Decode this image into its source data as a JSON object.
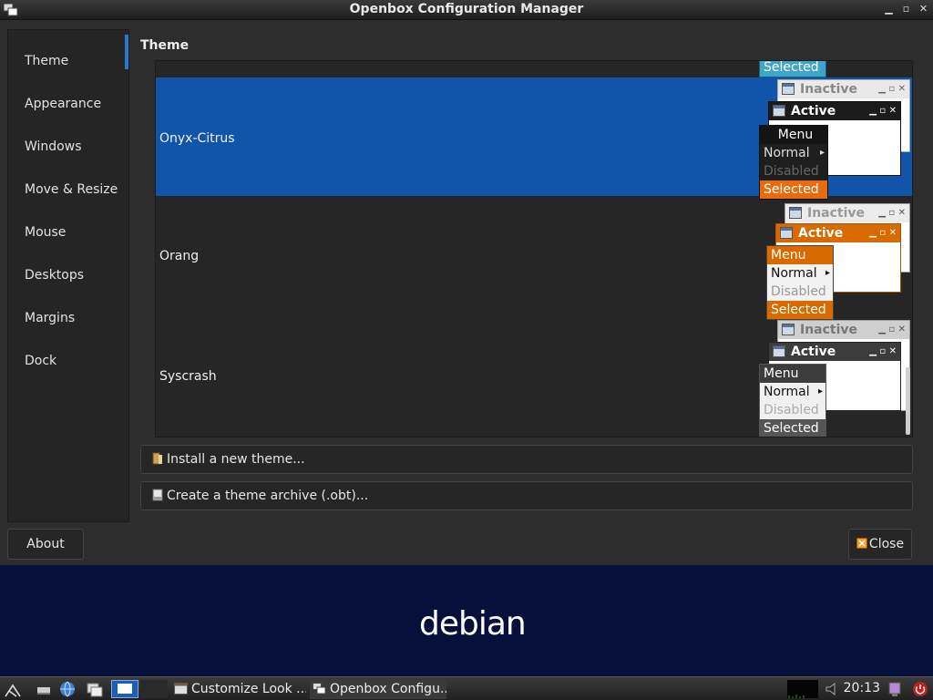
{
  "window": {
    "title": "Openbox Configuration Manager",
    "controls": [
      "minimize",
      "maximize",
      "close"
    ]
  },
  "sidebar": {
    "items": [
      {
        "label": "Theme"
      },
      {
        "label": "Appearance"
      },
      {
        "label": "Windows"
      },
      {
        "label": "Move & Resize"
      },
      {
        "label": "Mouse"
      },
      {
        "label": "Desktops"
      },
      {
        "label": "Margins"
      },
      {
        "label": "Dock"
      }
    ],
    "selected_index": 0
  },
  "main": {
    "section_title": "Theme",
    "themes": [
      {
        "name": "Onyx-Citrus",
        "selected": true
      },
      {
        "name": "Orang",
        "selected": false
      },
      {
        "name": "Syscrash",
        "selected": false
      }
    ],
    "top_cut_label": "Selected",
    "preview": {
      "inactive": "Inactive",
      "active": "Active",
      "menu": "Menu",
      "normal": "Normal",
      "disabled": "Disabled",
      "selected": "Selected"
    },
    "install_button": "Install a new theme...",
    "archive_button": "Create a theme archive (.obt)..."
  },
  "footer": {
    "about_button": "About",
    "close_button": "Close"
  },
  "desktop": {
    "logo_text": "debian"
  },
  "taskbar": {
    "tasks": [
      {
        "label": "Customize Look ..."
      },
      {
        "label": "Openbox Configu..."
      }
    ],
    "clock": "20:13"
  },
  "colors": {
    "selection": "#1155aa",
    "orange": "#e07000",
    "desktop_bg": "#07103a"
  }
}
